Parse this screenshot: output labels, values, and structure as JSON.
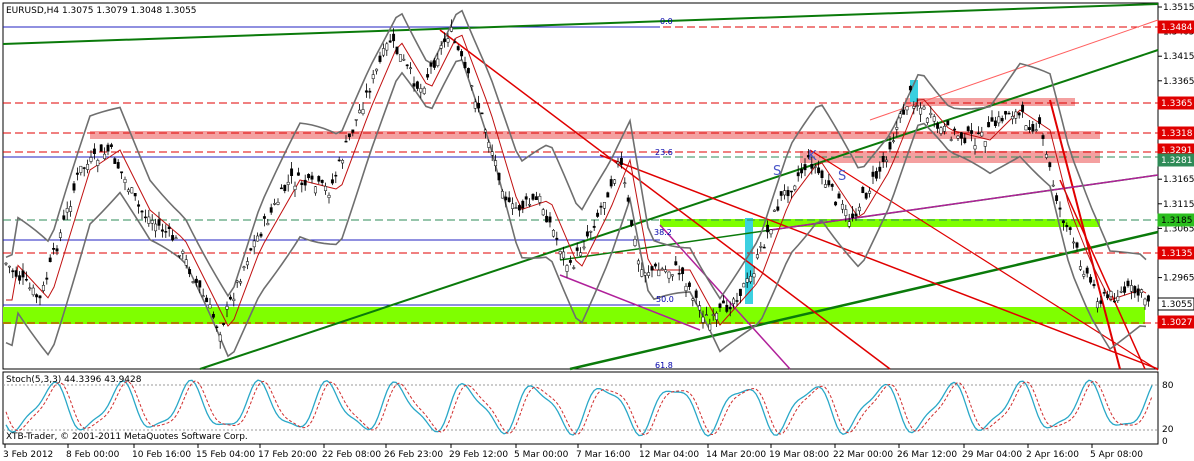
{
  "window": {
    "symbol_header": "EURUSD,H4  1.3075 1.3079 1.3048 1.3055",
    "indicator_header": "Stoch(5,3,3) 44.3396 43.9428",
    "copyright": "XTB-Trader, © 2001-2011 MetaQuotes Software Corp."
  },
  "price_axis": {
    "ticks": [
      "1.3515",
      "1.3465",
      "1.3415",
      "1.3365",
      "1.3315",
      "1.3265",
      "1.3215",
      "1.3165",
      "1.3115",
      "1.3065",
      "1.3015",
      "1.2965"
    ]
  },
  "price_tags": [
    {
      "value": "1.3484",
      "color": "#e00000"
    },
    {
      "value": "1.3365",
      "color": "#e00000"
    },
    {
      "value": "1.3318",
      "color": "#e00000"
    },
    {
      "value": "1.3291",
      "color": "#e00000"
    },
    {
      "value": "1.3281",
      "color": "#2e8b57"
    },
    {
      "value": "1.3185",
      "color": "#2bbf1f"
    },
    {
      "value": "1.3135",
      "color": "#e00000"
    },
    {
      "value": "1.3055",
      "color": "#ffffff"
    },
    {
      "value": "1.3027",
      "color": "#e00000"
    }
  ],
  "fib_labels": [
    "0.0",
    "23.6",
    "38.2",
    "50.0",
    "61.8"
  ],
  "wave_labels": [
    "S",
    "K",
    "S"
  ],
  "stoch_axis": {
    "ticks": [
      "80",
      "20",
      "0"
    ]
  },
  "time_axis": {
    "labels": [
      "3 Feb 2012",
      "8 Feb 00:00",
      "10 Feb 16:00",
      "15 Feb 04:00",
      "17 Feb 20:00",
      "22 Feb 08:00",
      "26 Feb 23:00",
      "29 Feb 12:00",
      "5 Mar 00:00",
      "7 Mar 16:00",
      "12 Mar 04:00",
      "14 Mar 20:00",
      "19 Mar 08:00",
      "22 Mar 00:00",
      "26 Mar 12:00",
      "29 Mar 04:00",
      "2 Apr 16:00",
      "5 Apr 08:00"
    ]
  },
  "colors": {
    "resistance": "#e00000",
    "support_band": "#7fff00",
    "trend_green": "#0a7a0a",
    "trend_red": "#e00000",
    "trend_magenta": "#b0209a",
    "bollinger": "#6f6f6f",
    "stoch_main": "#2aa8c8",
    "stoch_signal": "#d03030"
  }
}
